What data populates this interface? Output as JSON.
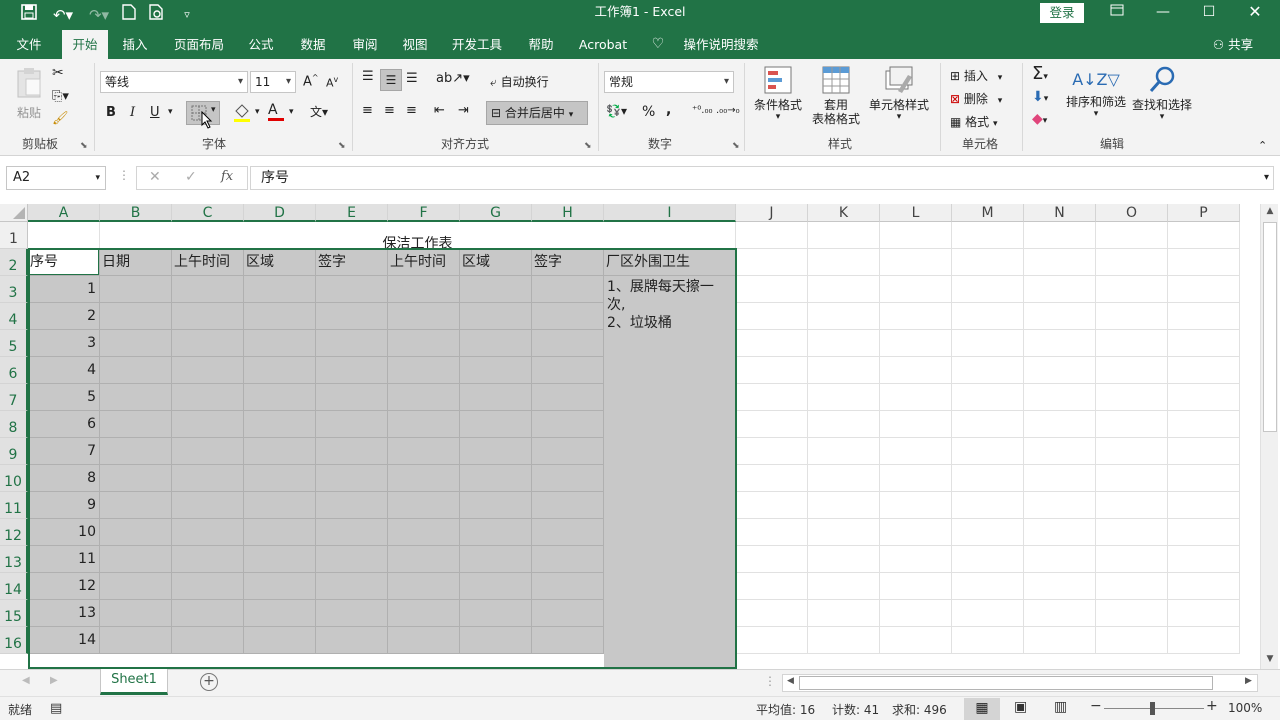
{
  "titlebar": {
    "title": "工作簿1  -  Excel",
    "login_label": "登录",
    "quick_access": [
      "save-icon",
      "undo-icon",
      "redo-icon",
      "new-icon",
      "print-preview-icon",
      "customize-icon"
    ]
  },
  "menubar": {
    "tabs": [
      "文件",
      "开始",
      "插入",
      "页面布局",
      "公式",
      "数据",
      "审阅",
      "视图",
      "开发工具",
      "帮助",
      "Acrobat"
    ],
    "active_tab": "开始",
    "tell_me": "操作说明搜索",
    "share": "共享"
  },
  "ribbon": {
    "clipboard": {
      "paste": "粘贴",
      "label": "剪贴板"
    },
    "font": {
      "name": "等线",
      "size": "11",
      "bold": "B",
      "italic": "I",
      "underline": "U",
      "label": "字体"
    },
    "alignment": {
      "wrap": "自动换行",
      "merge": "合并后居中",
      "label": "对齐方式"
    },
    "number": {
      "format": "常规",
      "label": "数字"
    },
    "styles": {
      "conditional": "条件格式",
      "table_line1": "套用",
      "table_line2": "表格格式",
      "cell_styles": "单元格样式",
      "label": "样式"
    },
    "cells": {
      "insert": "插入",
      "delete": "删除",
      "format": "格式",
      "label": "单元格"
    },
    "editing": {
      "sort": "排序和筛选",
      "find": "查找和选择",
      "label": "编辑"
    }
  },
  "formula": {
    "name_box": "A2",
    "content": "序号"
  },
  "grid": {
    "columns": [
      "A",
      "B",
      "C",
      "D",
      "E",
      "F",
      "G",
      "H",
      "I",
      "J",
      "K",
      "L",
      "M",
      "N",
      "O",
      "P"
    ],
    "rows": [
      "1",
      "2",
      "3",
      "4",
      "5",
      "6",
      "7",
      "8",
      "9",
      "10",
      "11",
      "12",
      "13",
      "14",
      "15",
      "16"
    ],
    "title": "保洁工作表",
    "headers": [
      "序号",
      "日期",
      "上午时间",
      "区域",
      "签字",
      "上午时间",
      "区域",
      "签字",
      "厂区外围卫生"
    ],
    "serials": [
      "1",
      "2",
      "3",
      "4",
      "5",
      "6",
      "7",
      "8",
      "9",
      "10",
      "11",
      "12",
      "13",
      "14"
    ],
    "note_lines": [
      "1、展牌每天擦一",
      "次,",
      "2、垃圾桶"
    ]
  },
  "sheets": {
    "tabs": [
      "Sheet1"
    ],
    "active": "Sheet1"
  },
  "status": {
    "mode": "就绪",
    "average": "平均值: 16",
    "count": "计数: 41",
    "sum": "求和: 496",
    "zoom": "100%"
  }
}
